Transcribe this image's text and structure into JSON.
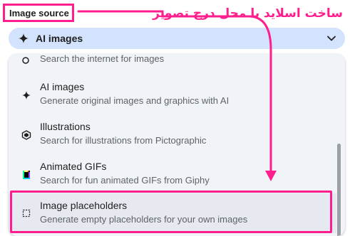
{
  "header": {
    "label": "Image source",
    "annotation": "ساخت اسلاید با محل درج تصویر"
  },
  "select": {
    "value": "AI images",
    "icon": "sparkle-icon"
  },
  "menu": {
    "items": [
      {
        "title": "",
        "desc": "Search the internet for images",
        "icon": "search-icon"
      },
      {
        "title": "AI images",
        "desc": "Generate original images and graphics with AI",
        "icon": "sparkle-icon"
      },
      {
        "title": "Illustrations",
        "desc": "Search for illustrations from Pictographic",
        "icon": "pictographic-icon"
      },
      {
        "title": "Animated GIFs",
        "desc": "Search for fun animated GIFs from Giphy",
        "icon": "giphy-icon"
      },
      {
        "title": "Image placeholders",
        "desc": "Generate empty placeholders for your own images",
        "icon": "placeholder-icon"
      }
    ]
  },
  "colors": {
    "accent": "#ff1e8e",
    "select_bg": "#d3e3fd",
    "menu_bg": "#f0f4f9"
  }
}
